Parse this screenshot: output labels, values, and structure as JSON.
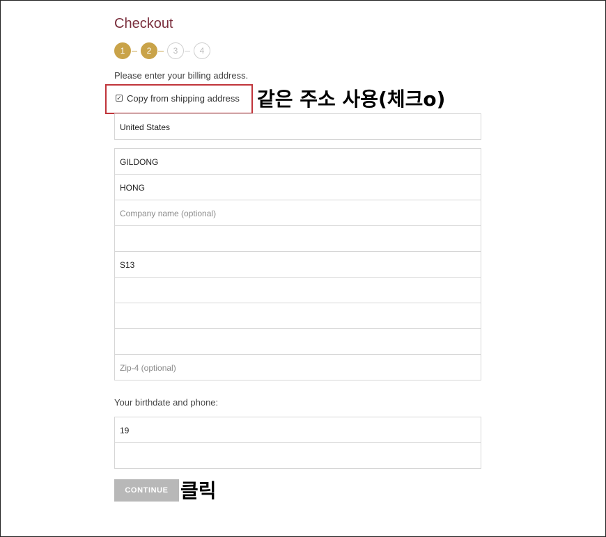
{
  "checkout": {
    "title": "Checkout",
    "steps": [
      {
        "label": "1",
        "state": "done"
      },
      {
        "label": "2",
        "state": "done"
      },
      {
        "label": "3",
        "state": "todo"
      },
      {
        "label": "4",
        "state": "todo"
      }
    ],
    "billing_prompt": "Please enter your billing address.",
    "copy_shipping": {
      "label": "Copy from shipping address",
      "checked": true
    }
  },
  "billing": {
    "country": "United States",
    "first_name": "GILDONG",
    "last_name": "HONG",
    "company_placeholder": "Company name (optional)",
    "address_line1": "",
    "address_line2": "S13",
    "city": "",
    "state": "",
    "zip": "",
    "zip4_placeholder": "Zip-4 (optional)"
  },
  "birth": {
    "label": "Your birthdate and phone:",
    "birthdate": "19",
    "phone": ""
  },
  "actions": {
    "continue_label": "CONTINUE"
  },
  "annotations": {
    "copy_note": "같은 주소  사용(체크o)",
    "click_note": "클릭"
  },
  "colors": {
    "title": "#7a2e3c",
    "step_done": "#c9a349",
    "highlight_box": "#c0343a",
    "continue_button": "#b8b8b8"
  }
}
